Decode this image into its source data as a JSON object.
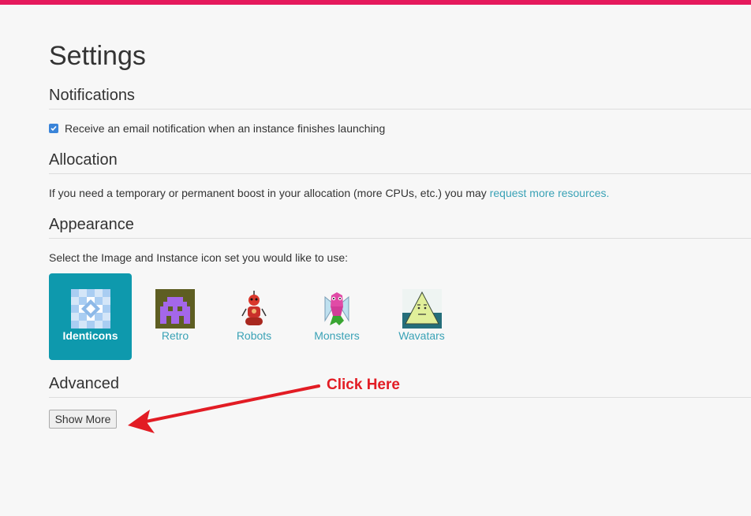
{
  "page": {
    "title": "Settings"
  },
  "notifications": {
    "heading": "Notifications",
    "email_checkbox_checked": true,
    "email_label": "Receive an email notification when an instance finishes launching"
  },
  "allocation": {
    "heading": "Allocation",
    "text": "If you need a temporary or permanent boost in your allocation (more CPUs, etc.) you may ",
    "link": "request more resources."
  },
  "appearance": {
    "heading": "Appearance",
    "prompt": "Select the Image and Instance icon set you would like to use:",
    "icon_sets": [
      {
        "label": "Identicons",
        "selected": true
      },
      {
        "label": "Retro",
        "selected": false
      },
      {
        "label": "Robots",
        "selected": false
      },
      {
        "label": "Monsters",
        "selected": false
      },
      {
        "label": "Wavatars",
        "selected": false
      }
    ]
  },
  "advanced": {
    "heading": "Advanced",
    "show_more_label": "Show More"
  },
  "annotation": {
    "callout_text": "Click Here",
    "color": "#e21c24"
  },
  "colors": {
    "accent_bar": "#e5195c",
    "selected_tile": "#0e99ad",
    "link": "#3aa2b6"
  }
}
